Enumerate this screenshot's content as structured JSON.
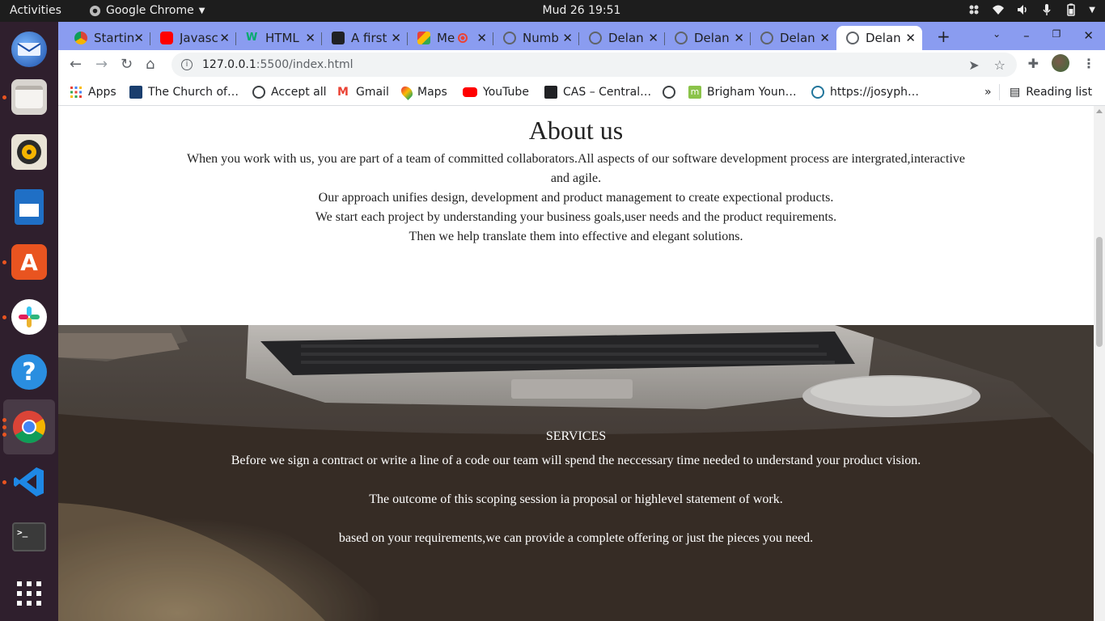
{
  "system": {
    "activities": "Activities",
    "app_name": "Google Chrome",
    "clock": "Mud 26  19:51"
  },
  "tabs": [
    {
      "title": "Startin",
      "color": "#fbbc04"
    },
    {
      "title": "Javasc",
      "color": "#ff0000"
    },
    {
      "title": "HTML",
      "color": "#00b27a"
    },
    {
      "title": "A first",
      "color": "#202124"
    },
    {
      "title": "Me",
      "color": "#34a853"
    },
    {
      "title": "Numb",
      "color": "#5f6368"
    },
    {
      "title": "Delan",
      "color": "#5f6368"
    },
    {
      "title": "Delan",
      "color": "#5f6368"
    },
    {
      "title": "Delan",
      "color": "#5f6368"
    },
    {
      "title": "Delan",
      "color": "#5f6368"
    }
  ],
  "address": {
    "host": "127.0.0.1",
    "path": ":5500/index.html"
  },
  "bookmarks": [
    {
      "label": "Apps",
      "icon": "apps-grid-icon"
    },
    {
      "label": "The Church of…",
      "icon": "church-icon"
    },
    {
      "label": "Accept all",
      "icon": "globe-icon"
    },
    {
      "label": "Gmail",
      "icon": "gmail-icon"
    },
    {
      "label": "Maps",
      "icon": "maps-icon"
    },
    {
      "label": "YouTube",
      "icon": "youtube-icon"
    },
    {
      "label": "CAS – Central…",
      "icon": "byu-icon"
    },
    {
      "label": "",
      "icon": "globe-icon"
    },
    {
      "label": "Brigham Youn…",
      "icon": "moodle-icon"
    },
    {
      "label": "https://josyph…",
      "icon": "wordpress-icon"
    }
  ],
  "reading_list": "Reading list",
  "about": {
    "title": "About us",
    "p1": "When you work with us, you are part of a team of committed collaborators.All aspects of our software development process are intergrated,interactive and agile.",
    "p2": "Our approach unifies design, development and product management to create expectional products.",
    "p3": "We start each project by understanding your business goals,user needs and the product requirements.",
    "p4": "Then we help translate them into effective and elegant solutions."
  },
  "services": {
    "title": "SERVICES",
    "p1": "Before we sign a contract or write a line of a code our team will spend the neccessary time needed to understand your product vision.",
    "p2": "The outcome of this scoping session ia proposal or highlevel statement of work.",
    "p3": "based on your requirements,we can provide a complete offering or just the pieces you need."
  },
  "dock": [
    {
      "name": "thunderbird"
    },
    {
      "name": "files"
    },
    {
      "name": "rhythmbox"
    },
    {
      "name": "libreoffice-writer"
    },
    {
      "name": "ubuntu-software"
    },
    {
      "name": "slack"
    },
    {
      "name": "help"
    },
    {
      "name": "chrome"
    },
    {
      "name": "vscode"
    },
    {
      "name": "terminal"
    },
    {
      "name": "show-apps"
    }
  ]
}
